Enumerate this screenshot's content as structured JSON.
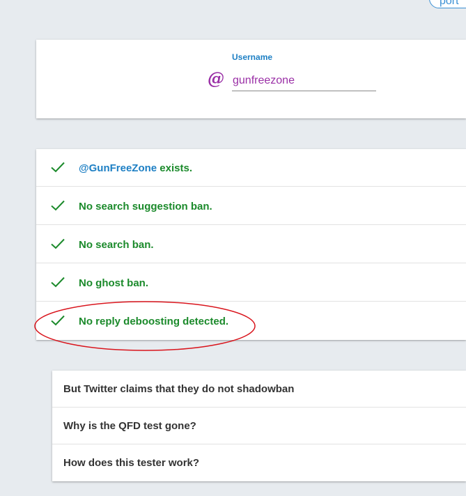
{
  "header": {
    "pill_label": "port"
  },
  "username_form": {
    "label": "Username",
    "at_symbol": "@",
    "value": "gunfreezone",
    "accent_color": "#9a2fa6"
  },
  "results": {
    "check_color": "#1b8a2b",
    "items": [
      {
        "handle": "@GunFreeZone",
        "text": " exists.",
        "icon": "check-icon"
      },
      {
        "handle": "",
        "text": "No search suggestion ban.",
        "icon": "check-icon"
      },
      {
        "handle": "",
        "text": "No search ban.",
        "icon": "check-icon"
      },
      {
        "handle": "",
        "text": "No ghost ban.",
        "icon": "check-icon"
      },
      {
        "handle": "",
        "text": "No reply deboosting detected.",
        "icon": "check-icon"
      }
    ]
  },
  "annotation": {
    "circle_color": "#d9141c"
  },
  "faq": {
    "items": [
      {
        "question": "But Twitter claims that they do not shadowban"
      },
      {
        "question": "Why is the QFD test gone?"
      },
      {
        "question": "How does this tester work?"
      }
    ]
  }
}
